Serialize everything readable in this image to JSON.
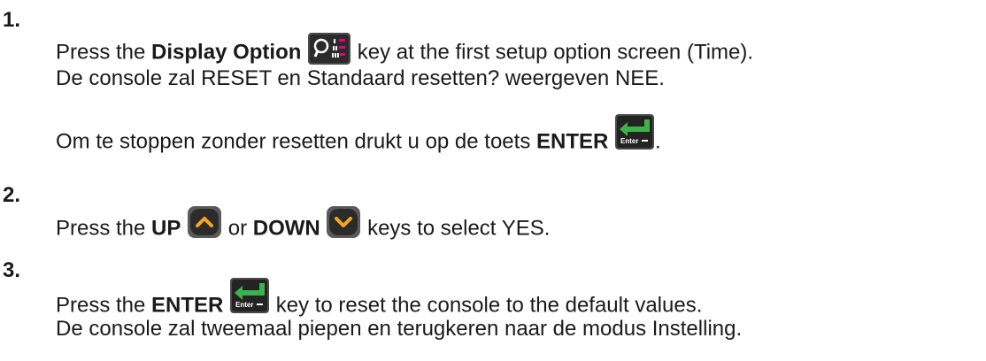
{
  "steps": [
    {
      "number": "1.",
      "line1": {
        "pre": "Press the ",
        "bold": "Display Option",
        "post": " key at the first setup option screen (Time)."
      },
      "line2": "De console zal RESET en Standaard resetten? weergeven NEE.",
      "line3": {
        "pre": "Om te stoppen zonder resetten drukt u op de toets ",
        "bold": "ENTER",
        "post": "."
      }
    },
    {
      "number": "2.",
      "line1": {
        "pre": "Press the ",
        "bold_up": "UP",
        "mid": " or ",
        "bold_down": "DOWN",
        "post": " keys to select YES."
      }
    },
    {
      "number": "3.",
      "line1": {
        "pre": "Press the ",
        "bold": "ENTER",
        "post": " key to reset the console to the default values."
      },
      "line2": "De console zal tweemaal piepen en terugkeren naar de modus Instelling."
    }
  ],
  "icons": {
    "display_option": "display-option-key-icon",
    "enter": "enter-key-icon",
    "enter_label": "Enter",
    "up": "up-key-icon",
    "down": "down-key-icon",
    "accent_green": "#3bb24a",
    "accent_magenta": "#e8007f",
    "accent_orange": "#f5a623"
  }
}
